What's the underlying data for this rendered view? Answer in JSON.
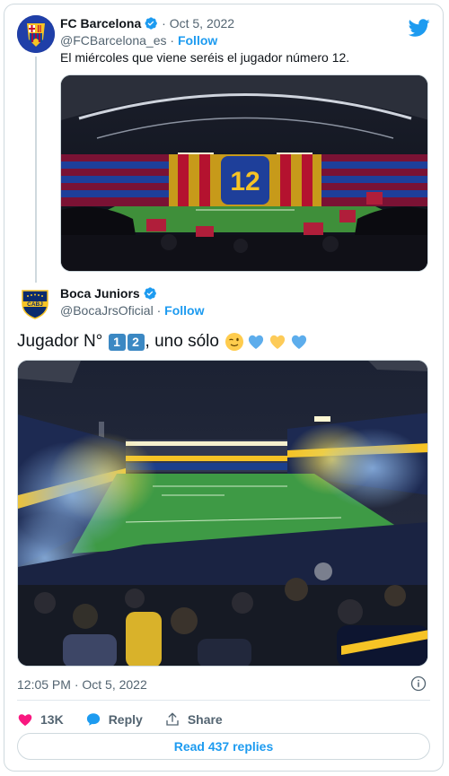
{
  "quoted": {
    "name": "FC Barcelona",
    "separator": "·",
    "date": "Oct 5, 2022",
    "handle": "@FCBarcelona_es",
    "follow_label": "Follow",
    "text": "El miércoles que viene seréis el jugador número 12.",
    "image_alt": "stadium-mosaic-12",
    "image_label": "12"
  },
  "main": {
    "name": "Boca Juniors",
    "handle": "@BocaJrsOficial",
    "separator": "·",
    "follow_label": "Follow",
    "avatar_text": "CABJ",
    "text_prefix": "Jugador N°",
    "keycap_1": "1",
    "keycap_2": "2",
    "text_suffix": ", uno sólo",
    "image_alt": "boca-stadium-smoke"
  },
  "meta": {
    "time": "12:05 PM · Oct 5, 2022"
  },
  "actions": {
    "like_count": "13K",
    "reply_label": "Reply",
    "share_label": "Share",
    "read_replies_label": "Read 437 replies"
  },
  "colors": {
    "accent": "#1d9bf0",
    "like": "#f91880",
    "boca_blue": "#0a2b6e",
    "boca_yellow": "#f6c325",
    "barca_blue": "#004d98",
    "barca_red": "#a50044"
  }
}
